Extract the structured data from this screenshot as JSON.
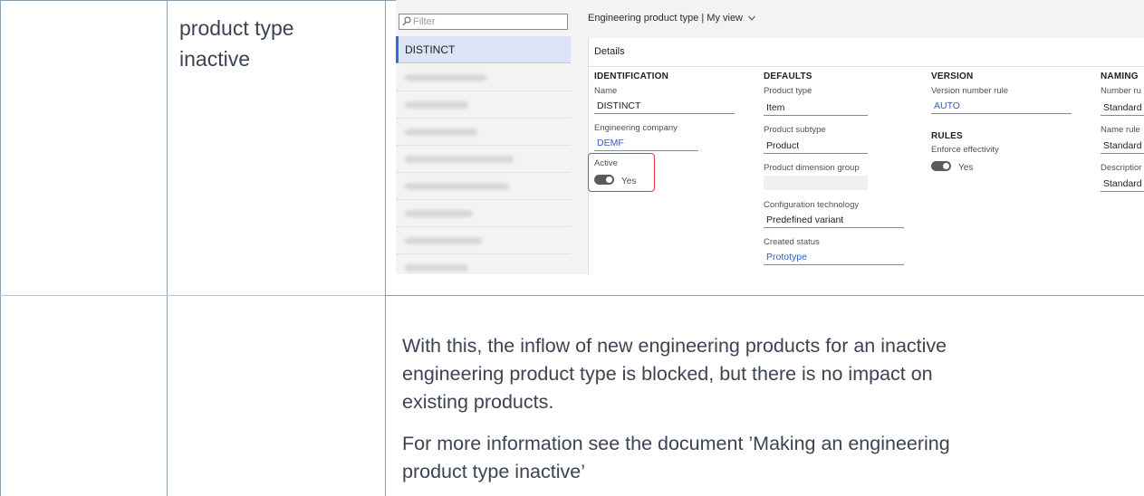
{
  "cell": {
    "title_line1": "product type",
    "title_line2": "inactive"
  },
  "screenshot": {
    "filter_placeholder": "Filter",
    "list_selected": "DISTINCT",
    "header_text": "Engineering product type  |  My view",
    "details_title": "Details",
    "identification": {
      "section": "IDENTIFICATION",
      "name_label": "Name",
      "name_value": "DISTINCT",
      "company_label": "Engineering company",
      "company_value": "DEMF",
      "active_label": "Active",
      "active_value": "Yes"
    },
    "defaults": {
      "section": "DEFAULTS",
      "product_type_label": "Product type",
      "product_type_value": "Item",
      "product_subtype_label": "Product subtype",
      "product_subtype_value": "Product",
      "dimension_group_label": "Product dimension group",
      "config_tech_label": "Configuration technology",
      "config_tech_value": "Predefined variant",
      "created_status_label": "Created status",
      "created_status_value": "Prototype"
    },
    "version": {
      "section": "VERSION",
      "rule_label": "Version number rule",
      "rule_value": "AUTO",
      "rules_section": "RULES",
      "enforce_label": "Enforce effectivity",
      "enforce_value": "Yes"
    },
    "naming": {
      "section": "NAMING",
      "number_rule_label": "Number ru",
      "number_rule_value": "Standard",
      "name_rule_label": "Name rule",
      "name_rule_value": "Standard",
      "description_label": "Descriptior",
      "description_value": "Standard"
    }
  },
  "paragraphs": {
    "p1_l1": "With this, the inflow of new engineering products for an inactive",
    "p1_l2": "engineering product type is blocked, but there is no impact on",
    "p1_l3": "existing products.",
    "p2_l1": "For more information see the document ’Making an engineering",
    "p2_l2": "product type inactive’"
  },
  "colors": {
    "accent": "#2f6bd9",
    "highlight_box": "#e03a3a",
    "link": "#2f5fc4"
  }
}
